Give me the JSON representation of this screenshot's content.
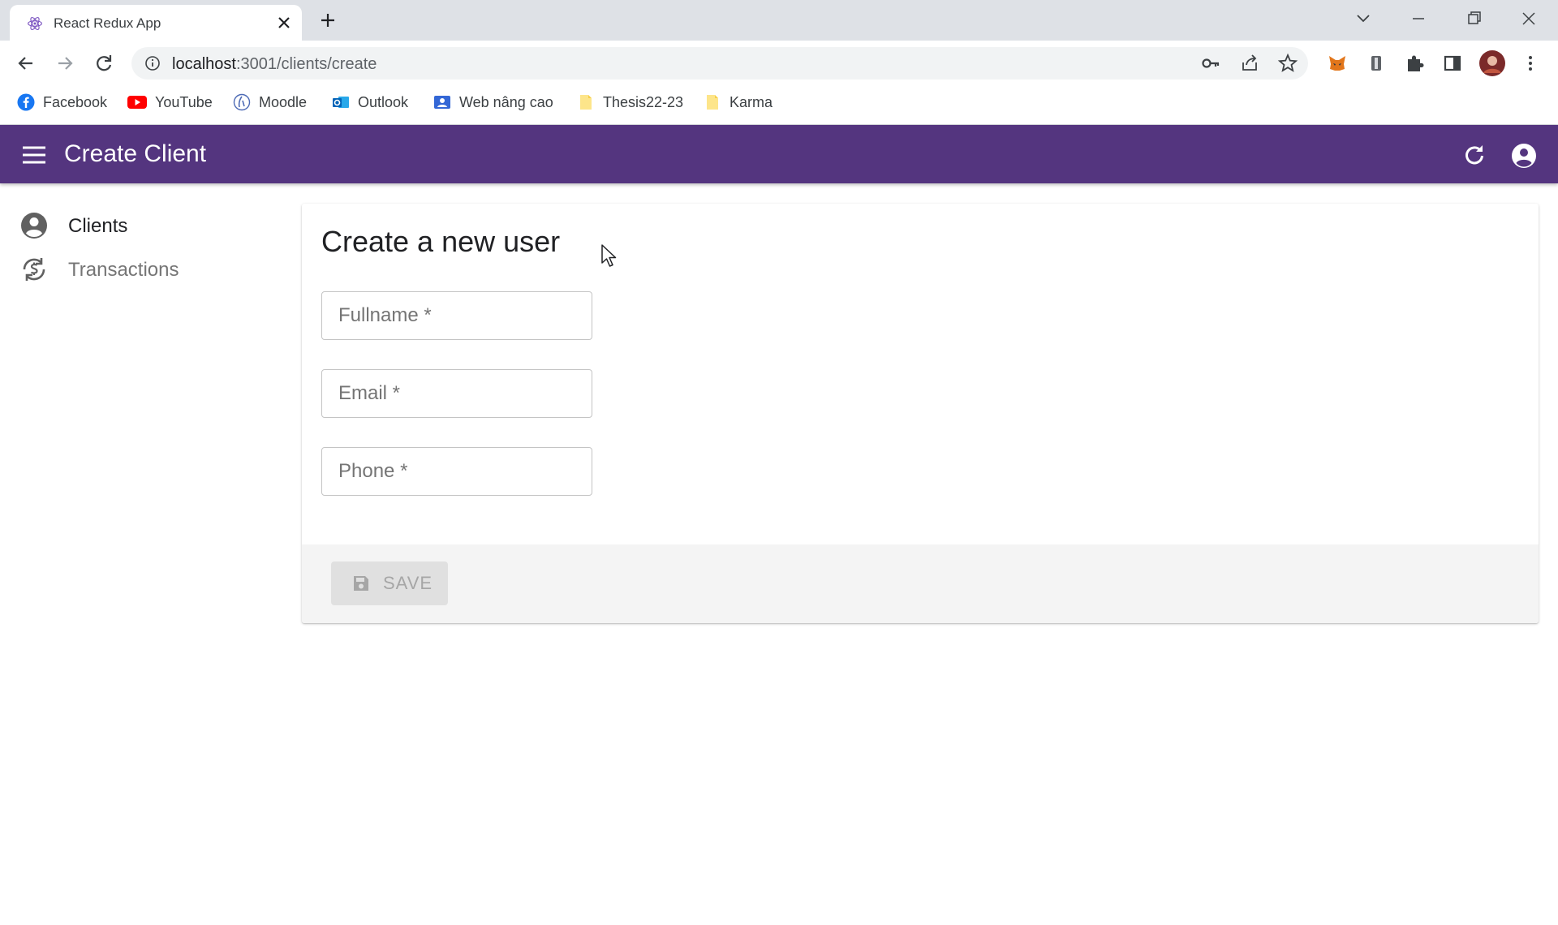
{
  "browser": {
    "tab": {
      "title": "React Redux App"
    },
    "url": {
      "host": "localhost",
      "path": ":3001/clients/create"
    },
    "bookmarks": [
      {
        "label": "Facebook",
        "icon": "facebook-icon"
      },
      {
        "label": "YouTube",
        "icon": "youtube-icon"
      },
      {
        "label": "Moodle",
        "icon": "moodle-icon"
      },
      {
        "label": "Outlook",
        "icon": "outlook-icon"
      },
      {
        "label": "Web nâng cao",
        "icon": "contact-icon"
      },
      {
        "label": "Thesis22-23",
        "icon": "folder-icon"
      },
      {
        "label": "Karma",
        "icon": "folder-icon"
      }
    ]
  },
  "appbar": {
    "title": "Create Client",
    "color": "#54357f"
  },
  "sidebar": {
    "items": [
      {
        "label": "Clients",
        "icon": "account-circle-icon",
        "active": true
      },
      {
        "label": "Transactions",
        "icon": "currency-exchange-icon",
        "active": false
      }
    ]
  },
  "form": {
    "heading": "Create a new user",
    "fields": [
      {
        "placeholder": "Fullname *",
        "value": ""
      },
      {
        "placeholder": "Email *",
        "value": ""
      },
      {
        "placeholder": "Phone *",
        "value": ""
      }
    ],
    "save_label": "SAVE"
  }
}
